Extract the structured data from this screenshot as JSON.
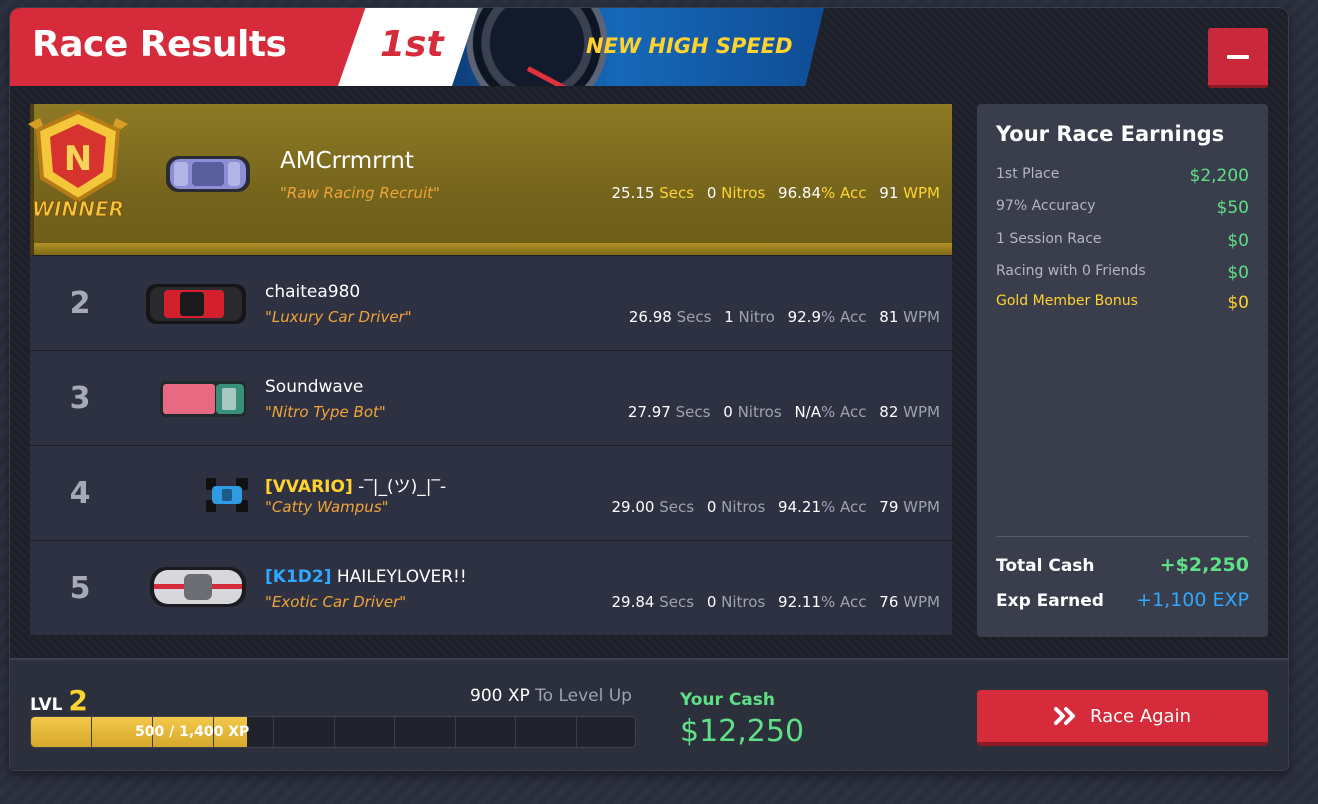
{
  "header": {
    "title": "Race Results",
    "place": "1st",
    "banner": "NEW HIGH SPEED"
  },
  "winner_badge_text": "WINNER",
  "winner_badge_letter": "N",
  "results": [
    {
      "rank": "1",
      "tag": "",
      "name": "AMCrrmrrnt",
      "title": "\"Raw Racing Recruit\"",
      "secs": "25.15",
      "secs_unit": "Secs",
      "nitros": "0",
      "nitros_unit": "Nitros",
      "acc": "96.84",
      "acc_unit": "% Acc",
      "wpm": "91",
      "wpm_unit": "WPM",
      "car_color": "#8c8fd6"
    },
    {
      "rank": "2",
      "tag": "",
      "name": "chaitea980",
      "title": "\"Luxury Car Driver\"",
      "secs": "26.98",
      "secs_unit": "Secs",
      "nitros": "1",
      "nitros_unit": "Nitro",
      "acc": "92.9",
      "acc_unit": "% Acc",
      "wpm": "81",
      "wpm_unit": "WPM",
      "car_color": "#2a2a2e"
    },
    {
      "rank": "3",
      "tag": "",
      "name": "Soundwave",
      "title": "\"Nitro Type Bot\"",
      "secs": "27.97",
      "secs_unit": "Secs",
      "nitros": "0",
      "nitros_unit": "Nitros",
      "acc": "N/A",
      "acc_unit": "% Acc",
      "wpm": "82",
      "wpm_unit": "WPM",
      "car_color": "#e86a82"
    },
    {
      "rank": "4",
      "tag": "[VVARIO]",
      "name": " -‾|_(ツ)_|‾-",
      "title": "\"Catty Wampus\"",
      "secs": "29.00",
      "secs_unit": "Secs",
      "nitros": "0",
      "nitros_unit": "Nitros",
      "acc": "94.21",
      "acc_unit": "% Acc",
      "wpm": "79",
      "wpm_unit": "WPM",
      "car_color": "#2f9be0"
    },
    {
      "rank": "5",
      "tag": "[K1D2]",
      "name": " HAILEYLOVER!!",
      "title": "\"Exotic Car Driver\"",
      "secs": "29.84",
      "secs_unit": "Secs",
      "nitros": "0",
      "nitros_unit": "Nitros",
      "acc": "92.11",
      "acc_unit": "% Acc",
      "wpm": "76",
      "wpm_unit": "WPM",
      "car_color": "#d8d8dc"
    }
  ],
  "earnings": {
    "heading": "Your Race Earnings",
    "lines": [
      {
        "label": "1st Place",
        "value": "$2,200"
      },
      {
        "label": "97% Accuracy",
        "value": "$50"
      },
      {
        "label": "1 Session Race",
        "value": "$0"
      },
      {
        "label": "Racing with 0 Friends",
        "value": "$0"
      },
      {
        "label": "Gold Member Bonus",
        "value": "$0"
      }
    ],
    "total_label": "Total Cash",
    "total_value": "+$2,250",
    "exp_label": "Exp Earned",
    "exp_value": "+1,100 EXP"
  },
  "level": {
    "label": "LVL",
    "value": "2",
    "xp_to_level": "900 XP",
    "xp_to_level_suffix": "To Level Up",
    "progress_text": "500 / 1,400 XP",
    "progress_fraction": 0.357
  },
  "cash": {
    "label": "Your Cash",
    "value": "$12,250"
  },
  "race_again_label": "Race Again",
  "colors": {
    "accent_red": "#d52b3a",
    "gold": "#ffd230",
    "green": "#5fe087",
    "blue": "#2fa8ff",
    "orange_title": "#f0a43a"
  }
}
